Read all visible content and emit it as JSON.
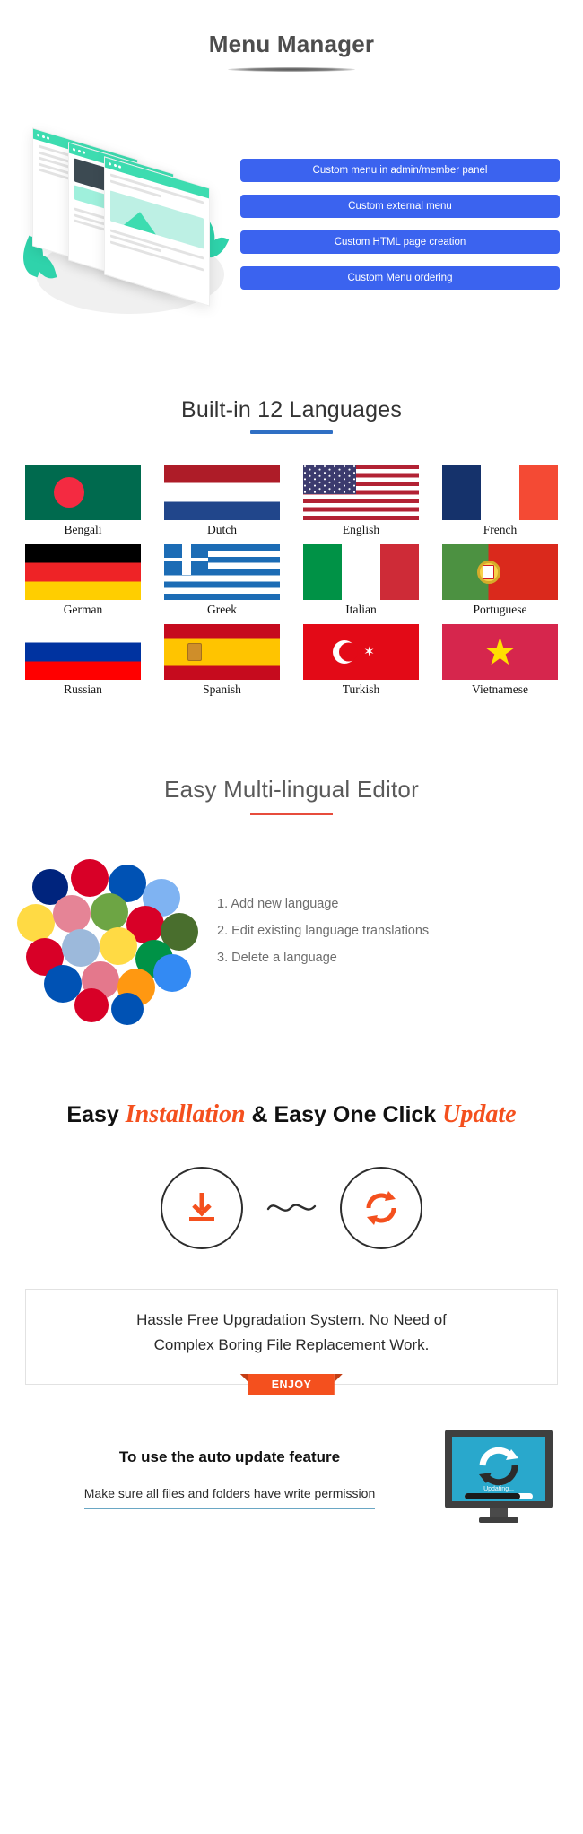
{
  "section_menu_manager": {
    "title": "Menu Manager",
    "buttons": [
      "Custom menu in admin/member panel",
      "Custom external menu",
      "Custom HTML page creation",
      "Custom Menu ordering"
    ],
    "button_color": "#3b63ef",
    "illustration_accent": "#2fd3ab"
  },
  "section_languages": {
    "title": "Built-in 12 Languages",
    "underline_color": "#2f6fc4",
    "languages": [
      {
        "label": "Bengali",
        "flag": "bangladesh-flag"
      },
      {
        "label": "Dutch",
        "flag": "netherlands-flag"
      },
      {
        "label": "English",
        "flag": "united-states-flag"
      },
      {
        "label": "French",
        "flag": "france-flag"
      },
      {
        "label": "German",
        "flag": "germany-flag"
      },
      {
        "label": "Greek",
        "flag": "greece-flag"
      },
      {
        "label": "Italian",
        "flag": "italy-flag"
      },
      {
        "label": "Portuguese",
        "flag": "portugal-flag"
      },
      {
        "label": "Russian",
        "flag": "russia-flag"
      },
      {
        "label": "Spanish",
        "flag": "spain-flag"
      },
      {
        "label": "Turkish",
        "flag": "turkey-flag"
      },
      {
        "label": "Vietnamese",
        "flag": "vietnam-flag"
      }
    ]
  },
  "section_editor": {
    "title": "Easy Multi-lingual Editor",
    "underline_color": "#e74c3c",
    "items": [
      "1. Add new language",
      "2. Edit existing language translations",
      "3. Delete a language"
    ]
  },
  "section_install": {
    "heading_part1": "Easy ",
    "heading_script1": "Installation",
    "heading_part2": " & Easy One Click ",
    "heading_script2": "Update",
    "accent_color": "#f4501e",
    "download_icon": "download-icon",
    "update_icon": "refresh-sync-icon",
    "note_line1": "Hassle Free Upgradation System. No Need of",
    "note_line2": "Complex Boring File Replacement Work.",
    "ribbon_label": "ENJOY"
  },
  "section_auto_update": {
    "heading": "To use the auto update feature",
    "subheading": "Make sure all files and folders have write permission",
    "underline_color": "#6aa7c4",
    "monitor_screen_color": "#29a8cc",
    "monitor_status_text": "Updating...",
    "monitor_progress_percent": 82
  }
}
